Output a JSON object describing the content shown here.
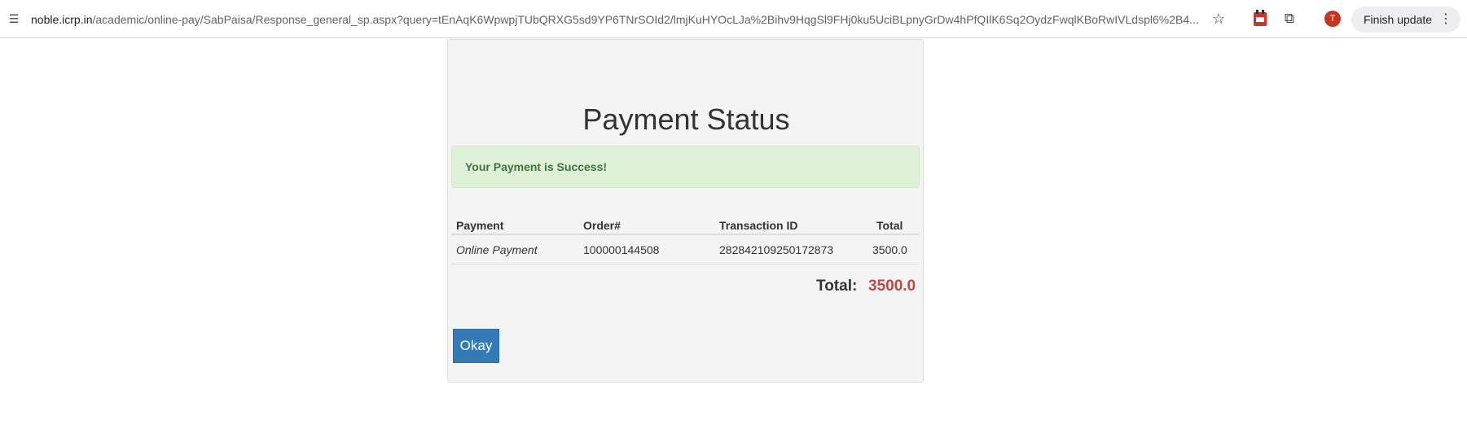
{
  "browser": {
    "url_host": "noble.icrp.in",
    "url_path": "/academic/online-pay/SabPaisa/Response_general_sp.aspx?query=tEnAqK6WpwpjTUbQRXG5sd9YP6TNrSOId2/lmjKuHYOcLJa%2Bihv9HqgSl9FHj0ku5UciBLpnyGrDw4hPfQIlK6Sq2OydzFwqlKBoRwIVLdspl6%2B4...",
    "avatar_letter": "T",
    "finish_update_label": "Finish update",
    "colors": {
      "avatar_bg": "#c8341f",
      "button_bg": "#eceef2"
    }
  },
  "page": {
    "title": "Payment Status",
    "alert_message": "Your Payment is Success!",
    "table": {
      "headers": [
        "Payment",
        "Order#",
        "Transaction ID",
        "Total"
      ],
      "rows": [
        [
          "Online Payment",
          "100000144508",
          "282842109250172873",
          "3500.0"
        ]
      ]
    },
    "total_label": "Total:",
    "total_value": "3500.0",
    "okay_label": "Okay",
    "colors": {
      "alert_bg": "#dff0d8",
      "alert_text": "#3c763d",
      "total_value": "#b94a48",
      "okay_bg": "#337ab7"
    }
  }
}
